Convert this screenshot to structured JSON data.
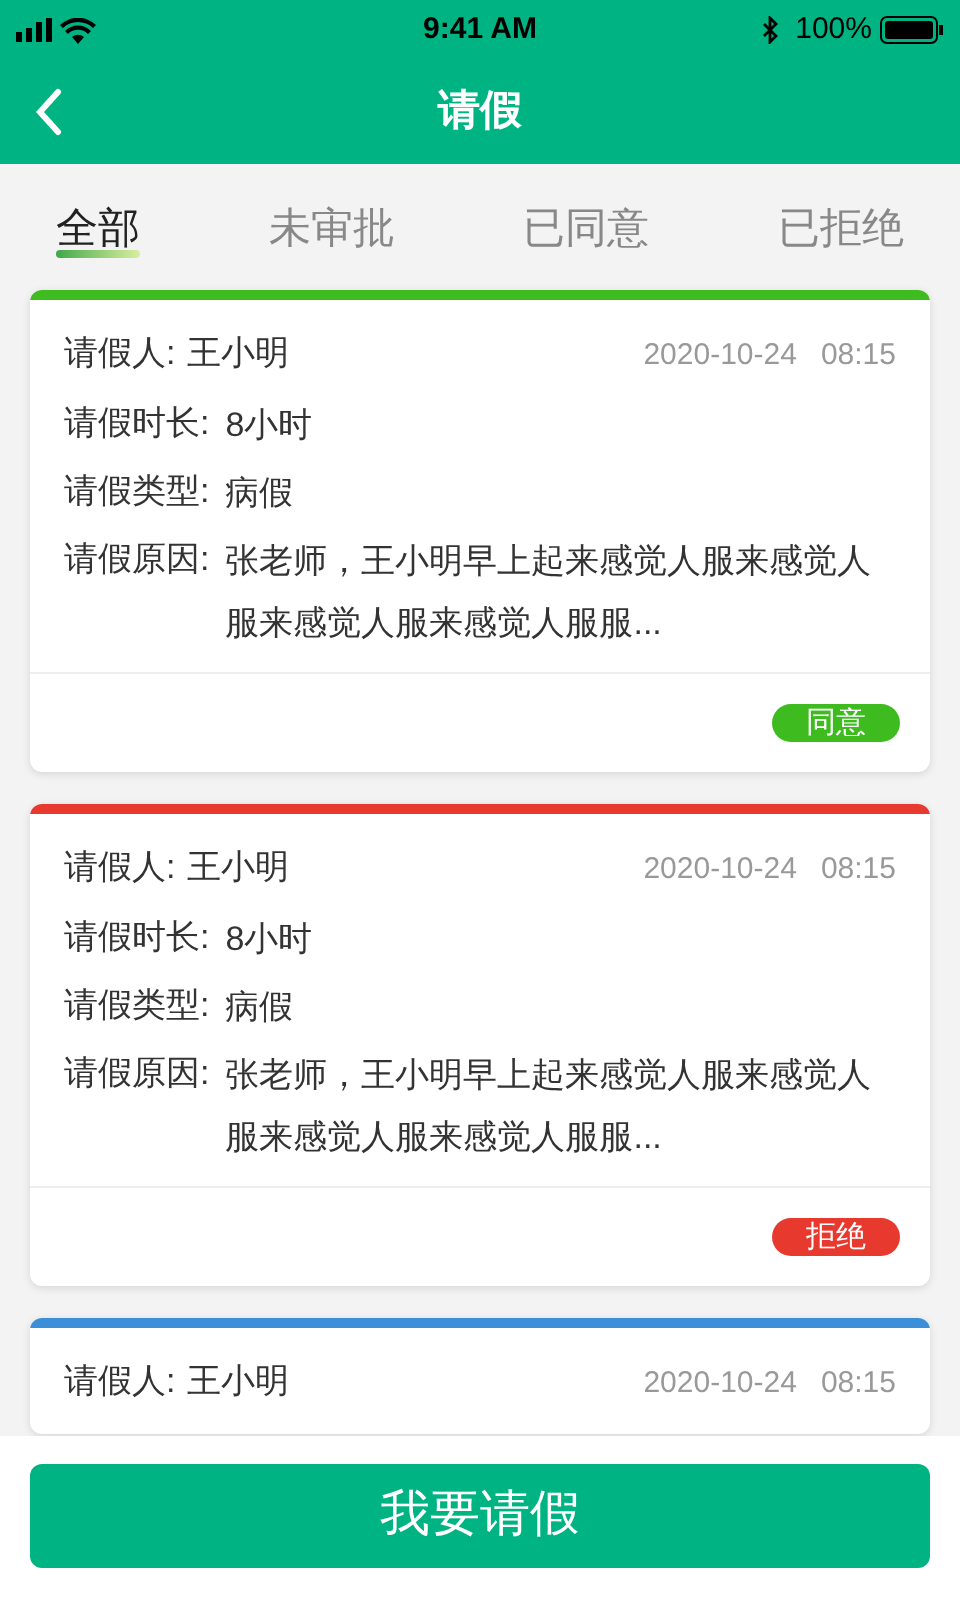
{
  "status_bar": {
    "time": "9:41 AM",
    "battery": "100%"
  },
  "header": {
    "title": "请假"
  },
  "tabs": [
    {
      "label": "全部",
      "selected": true
    },
    {
      "label": "未审批",
      "selected": false
    },
    {
      "label": "已同意",
      "selected": false
    },
    {
      "label": "已拒绝",
      "selected": false
    }
  ],
  "cards": [
    {
      "color": "#3dbb1f",
      "applicant_label": "请假人:",
      "applicant": "王小明",
      "date": "2020-10-24",
      "time": "08:15",
      "rows": [
        {
          "label": "请假时长:",
          "value": "8小时"
        },
        {
          "label": "请假类型:",
          "value": "病假"
        },
        {
          "label": "请假原因:",
          "value": "张老师，王小明早上起来感觉人服来感觉人服来感觉人服来感觉人服服..."
        }
      ],
      "status": "同意"
    },
    {
      "color": "#e8392e",
      "applicant_label": "请假人:",
      "applicant": "王小明",
      "date": "2020-10-24",
      "time": "08:15",
      "rows": [
        {
          "label": "请假时长:",
          "value": "8小时"
        },
        {
          "label": "请假类型:",
          "value": "病假"
        },
        {
          "label": "请假原因:",
          "value": "张老师，王小明早上起来感觉人服来感觉人服来感觉人服来感觉人服服..."
        }
      ],
      "status": "拒绝"
    },
    {
      "color": "#3a8fd8",
      "applicant_label": "请假人:",
      "applicant": "王小明",
      "date": "2020-10-24",
      "time": "08:15"
    }
  ],
  "action_button": "我要请假"
}
